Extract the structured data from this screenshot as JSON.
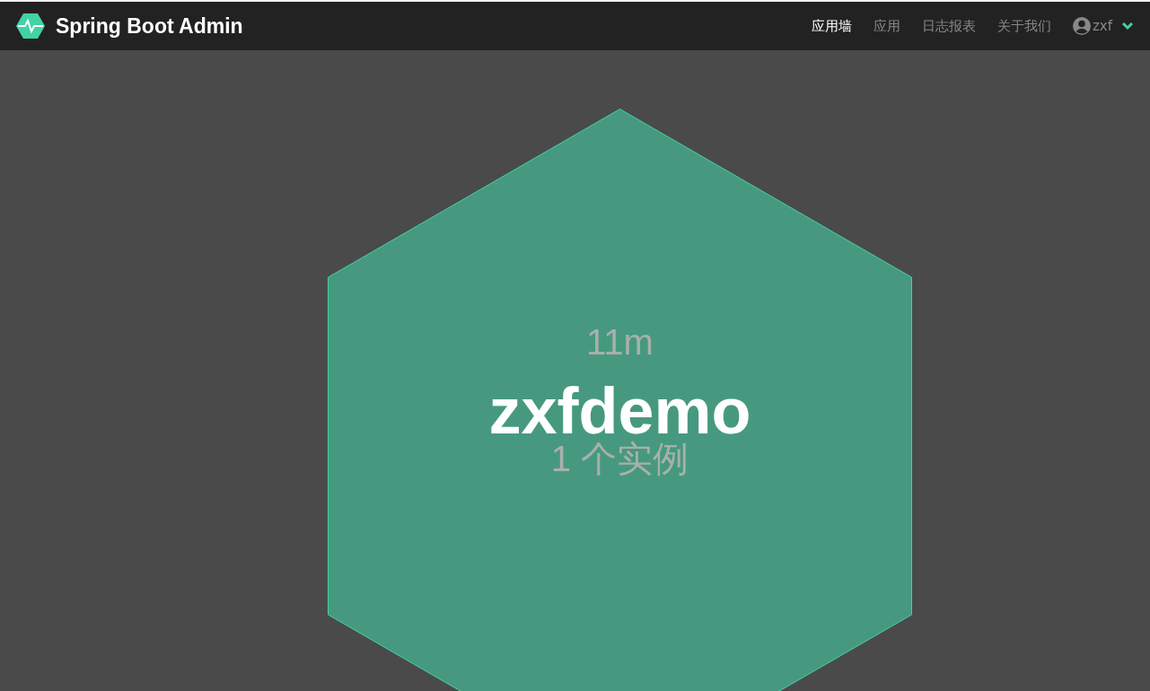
{
  "navbar": {
    "brand": "Spring Boot Admin",
    "links": [
      {
        "label": "应用墙",
        "selected": true
      },
      {
        "label": "应用",
        "selected": false
      },
      {
        "label": "日志报表",
        "selected": false
      },
      {
        "label": "关于我们",
        "selected": false
      }
    ],
    "user": "zxf"
  },
  "applications": [
    {
      "uptime": "11m",
      "name": "zxfdemo",
      "instances": "1 个实例",
      "color": "#46997f"
    }
  ]
}
